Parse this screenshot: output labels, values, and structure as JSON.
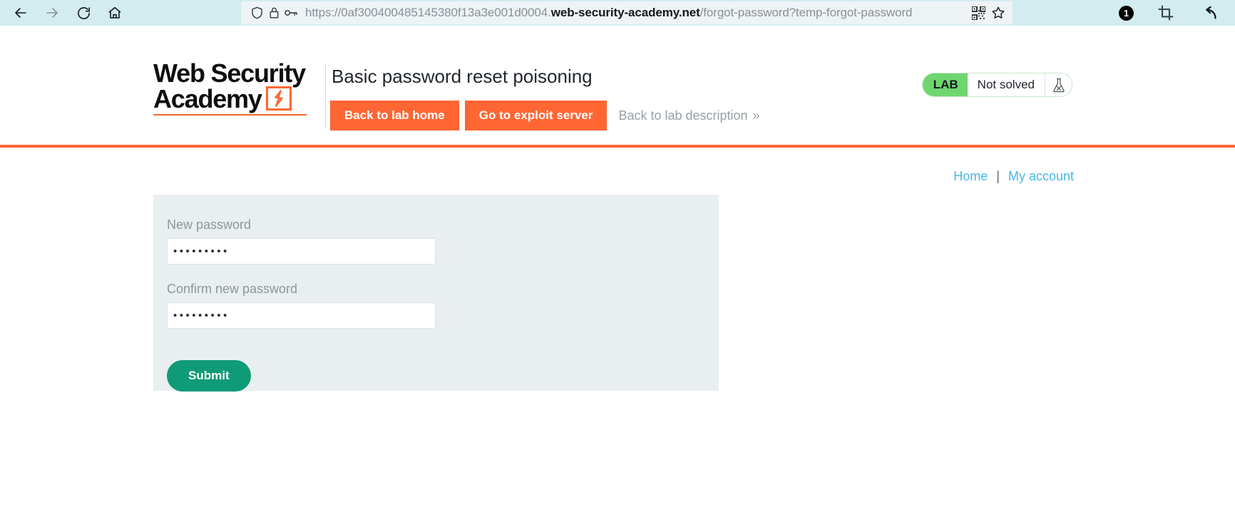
{
  "browser": {
    "back_icon": "back-arrow-icon",
    "forward_icon": "forward-arrow-icon",
    "reload_icon": "reload-icon",
    "home_icon": "home-icon",
    "shield_icon": "shield-icon",
    "lock_icon": "lock-icon",
    "key_icon": "key-icon",
    "qr_icon": "qr-code-icon",
    "star_icon": "star-bookmark-icon",
    "crop_icon": "crop-screenshot-icon",
    "undo_icon": "undo-arrow-icon",
    "notification_count": "1",
    "url": {
      "prefix": "https://0af300400485145380f13a3e001d0004.",
      "domain": "web-security-academy.net",
      "path": "/forgot-password?temp-forgot-password"
    }
  },
  "lab_header": {
    "logo_line1": "Web Security",
    "logo_line2": "Academy",
    "logo_bolt_icon": "lightning-bolt-icon",
    "title": "Basic password reset poisoning",
    "back_to_lab_home": "Back to lab home",
    "go_to_exploit_server": "Go to exploit server",
    "back_to_lab_description": "Back to lab description",
    "chevron": "»",
    "status_tag": "LAB",
    "status_state": "Not solved",
    "flask_icon": "flask-not-solved-icon",
    "accent_orange": "#ff6633",
    "status_green": "#6fd66f"
  },
  "account_nav": {
    "home": "Home",
    "separator": "|",
    "my_account": "My account"
  },
  "form": {
    "new_password_label": "New password",
    "new_password_value": "•••••••••",
    "new_password_placeholder": "",
    "confirm_password_label": "Confirm new password",
    "confirm_password_value": "•••••••••",
    "confirm_password_placeholder": "",
    "submit_label": "Submit",
    "submit_color": "#0f9b77",
    "panel_color": "#e9eff1"
  }
}
